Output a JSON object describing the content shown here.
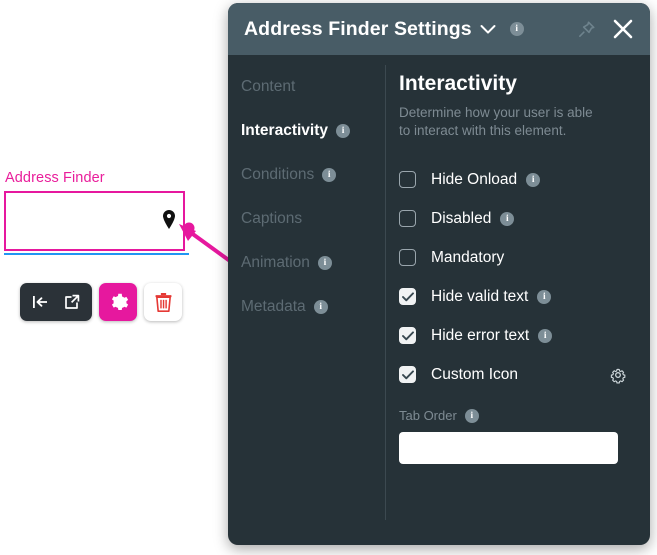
{
  "canvas": {
    "field": {
      "label": "Address Finder",
      "value": "",
      "icon": "map-pin-icon"
    },
    "toolbar": {
      "buttons": [
        {
          "name": "collapse-left-icon",
          "label": ""
        },
        {
          "name": "open-external-icon",
          "label": ""
        },
        {
          "name": "gear-icon",
          "label": ""
        },
        {
          "name": "trash-icon",
          "label": ""
        }
      ]
    }
  },
  "panel": {
    "title": "Address Finder Settings",
    "title_chevron": "chevron-down-icon",
    "title_info": "i",
    "pin": "pin-icon",
    "close": "close-icon",
    "nav": [
      {
        "label": "Content",
        "active": false,
        "info": null
      },
      {
        "label": "Interactivity",
        "active": true,
        "info": "i"
      },
      {
        "label": "Conditions",
        "active": false,
        "info": "i"
      },
      {
        "label": "Captions",
        "active": false,
        "info": null
      },
      {
        "label": "Animation",
        "active": false,
        "info": "i"
      },
      {
        "label": "Metadata",
        "active": false,
        "info": "i"
      }
    ],
    "content": {
      "heading": "Interactivity",
      "subtitle": "Determine how your user is able to interact with this element.",
      "checkboxes": [
        {
          "label": "Hide Onload",
          "checked": false,
          "info": "i"
        },
        {
          "label": "Disabled",
          "checked": false,
          "info": "i"
        },
        {
          "label": "Mandatory",
          "checked": false,
          "info": null
        },
        {
          "label": "Hide valid text",
          "checked": true,
          "info": "i"
        },
        {
          "label": "Hide error text",
          "checked": true,
          "info": "i"
        },
        {
          "label": "Custom Icon",
          "checked": true,
          "info": null,
          "trailing_icon": "gear-icon"
        }
      ],
      "tab_order": {
        "label": "Tab Order",
        "info": "i",
        "value": "",
        "placeholder": ""
      }
    }
  },
  "colors": {
    "accent_magenta": "#e6189e",
    "panel_bg": "#263238",
    "titlebar_bg": "#485c66",
    "field_underline": "#2196f3",
    "trash_red": "#e53935"
  }
}
